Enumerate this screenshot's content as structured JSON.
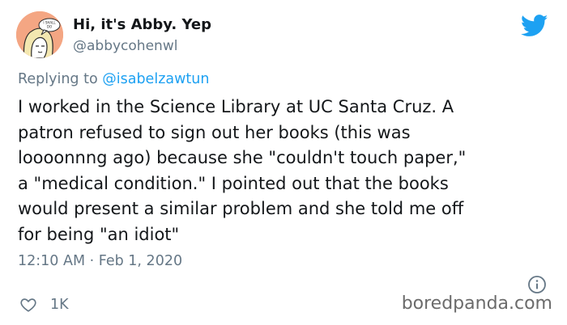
{
  "author": {
    "display_name": "Hi, it's Abby. Yep",
    "handle": "@abbycohenwl",
    "avatar_caption": "I SHALL DO"
  },
  "reply": {
    "prefix": "Replying to",
    "mention": "@isabelzawtun"
  },
  "tweet": {
    "lines": [
      "I worked in the Science Library at UC Santa Cruz. A",
      "patron refused to sign out her books (this was",
      "loooonnng ago) because she \"couldn't touch paper,\"",
      "a \"medical condition.\" I pointed out that the books",
      "would present a similar problem and she told me off",
      "for being \"an idiot\""
    ],
    "timestamp": "12:10 AM · Feb 1, 2020"
  },
  "actions": {
    "like_count": "1K"
  },
  "watermark": "boredpanda.com",
  "icons": {
    "brand": "twitter-bird-icon",
    "info": "info-icon",
    "like": "heart-icon"
  },
  "colors": {
    "twitter_blue": "#1da1f2",
    "secondary_text": "#657786",
    "primary_text": "#14171a",
    "avatar_bg": "#f4a683"
  }
}
